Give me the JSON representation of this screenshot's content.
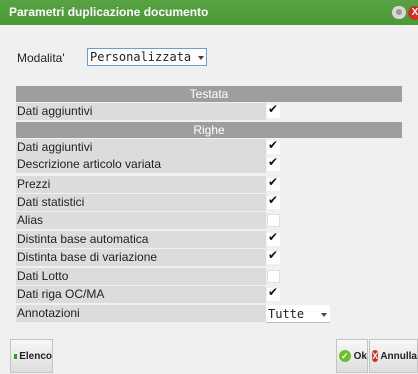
{
  "window": {
    "title": "Parametri duplicazione documento",
    "close_glyph": "X"
  },
  "mode": {
    "label": "Modalita'",
    "value": "Personalizzata"
  },
  "sections": {
    "testata": "Testata",
    "righe": "Righe"
  },
  "testata_rows": [
    {
      "label": "Dati aggiuntivi",
      "checked": true
    }
  ],
  "righe_rows": [
    {
      "label": "Dati aggiuntivi",
      "checked": true
    },
    {
      "label": "Descrizione articolo variata",
      "checked": true
    },
    {
      "label": "Prezzi",
      "checked": true
    },
    {
      "label": "Dati statistici",
      "checked": true
    },
    {
      "label": "Alias",
      "checked": false
    },
    {
      "label": "Distinta base automatica",
      "checked": true
    },
    {
      "label": "Distinta base di variazione",
      "checked": true
    },
    {
      "label": "Dati Lotto",
      "checked": false
    },
    {
      "label": "Dati riga OC/MA",
      "checked": true
    }
  ],
  "annotazioni": {
    "label": "Annotazioni",
    "value": "Tutte"
  },
  "buttons": {
    "elenco": "Elenco",
    "ok": "Ok",
    "annulla": "Annulla"
  },
  "icons": {
    "ok": "check-circle-icon",
    "annulla": "x-circle-icon",
    "elenco": "green-square-icon"
  },
  "colors": {
    "titlebar": "#4fa03a",
    "section": "#9e9e9e",
    "row": "#dcdcdc",
    "close": "#d0301f"
  }
}
